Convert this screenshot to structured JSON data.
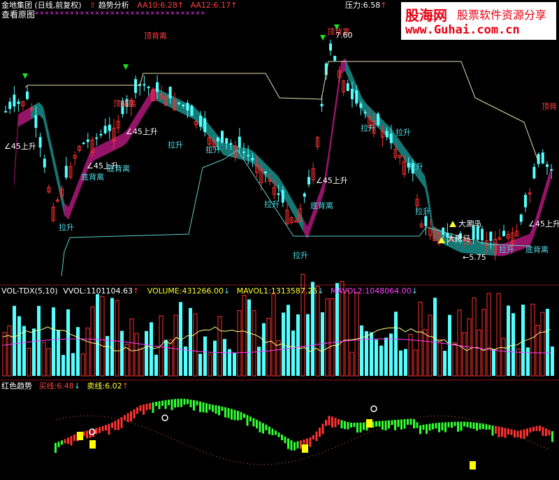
{
  "header": {
    "stock_title": "金地集团 (日线,前复权)",
    "indicator_name": "趋势分析",
    "aa10": "AA10:6.28",
    "aa12": "AA12:6.17",
    "pressure": "压力:6.58",
    "stars": "××××××××××××××××××××××××××××××××××××××××",
    "view_original": "查看原图"
  },
  "watermark": {
    "brand_cn": "股海网",
    "slogan": "股票软件资源分享",
    "url": "www.Guhai.com.cn"
  },
  "main_panel": {
    "labels": [
      {
        "text": "顶背离",
        "color": "red"
      },
      {
        "text": "顶背离",
        "color": "red"
      },
      {
        "text": "顶背离",
        "color": "red"
      },
      {
        "text": "顶背",
        "color": "red"
      },
      {
        "text": "7.60",
        "color": "white"
      },
      {
        "text": "∠45上升",
        "color": "white"
      },
      {
        "text": "∠45上升",
        "color": "white"
      },
      {
        "text": "∠45上升",
        "color": "white"
      },
      {
        "text": "∠45上升",
        "color": "white"
      },
      {
        "text": "∠45上升",
        "color": "white"
      },
      {
        "text": "底背离",
        "color": "cyan"
      },
      {
        "text": "底背离",
        "color": "cyan"
      },
      {
        "text": "底背离",
        "color": "cyan"
      },
      {
        "text": "底背离",
        "color": "cyan"
      },
      {
        "text": "拉升",
        "color": "cyan"
      },
      {
        "text": "拉升",
        "color": "cyan"
      },
      {
        "text": "拉升",
        "color": "cyan"
      },
      {
        "text": "拉升",
        "color": "cyan"
      },
      {
        "text": "拉升",
        "color": "cyan"
      },
      {
        "text": "拉升",
        "color": "cyan"
      },
      {
        "text": "拉升",
        "color": "cyan"
      },
      {
        "text": "拉升",
        "color": "cyan"
      },
      {
        "text": "拉升",
        "color": "cyan"
      },
      {
        "text": "拉升",
        "color": "cyan"
      },
      {
        "text": "大黑马",
        "color": "white"
      },
      {
        "text": "大黑马",
        "color": "white"
      },
      {
        "text": "←5.75",
        "color": "white"
      }
    ]
  },
  "volume_panel": {
    "title": "VOL-TDX(5,10)",
    "vvol": "VVOL:1101104.63",
    "volume": "VOLUME:431266.00",
    "mavol1": "MAVOL1:1313587.25",
    "mavol2": "MAVOL2:1048064.00"
  },
  "trend_panel": {
    "title": "红色趋势",
    "buy_line": "买线:6.48",
    "sell_line": "卖线:6.02"
  },
  "colors": {
    "up": "#ff3030",
    "down": "#54ffff",
    "panel_border": "#8a1a1a",
    "band_up": "#b0187a",
    "band_down": "#1a8c88",
    "ma_yellow": "#ffff80",
    "ma_magenta": "#ff40ff"
  }
}
